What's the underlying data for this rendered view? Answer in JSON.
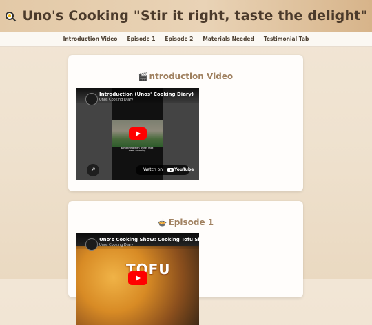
{
  "header": {
    "title": "Uno's Cooking \"Stir it right, taste the delight\"",
    "icon": "frying-pan-icon"
  },
  "nav": {
    "items": [
      {
        "label": "Introduction Video"
      },
      {
        "label": "Episode 1"
      },
      {
        "label": "Episode 2"
      },
      {
        "label": "Materials Needed"
      },
      {
        "label": "Testimonial Tab"
      }
    ]
  },
  "sections": [
    {
      "glyph": "🎬",
      "title": "ntroduction Video",
      "video": {
        "title": "Introduction (Unos' Cooking Diary)",
        "channel": "Unos Cooking Diary",
        "caption": "something with words that were amazing",
        "watch_label": "Watch on",
        "platform": "YouTube"
      }
    },
    {
      "glyph": "🍲",
      "title": "Episode 1",
      "video": {
        "title": "Uno's Cooking Show: Cooking Tofu Si",
        "channel": "Unos Cooking Diary",
        "overlay_word": "TOFU"
      }
    }
  ],
  "colors": {
    "background": "#efe2cf",
    "header_gradient_start": "#e3c9a7",
    "header_gradient_end": "#d7b48a",
    "title_text": "#4b3a2b",
    "section_title": "#a08160",
    "play_button": "#ff0000"
  }
}
